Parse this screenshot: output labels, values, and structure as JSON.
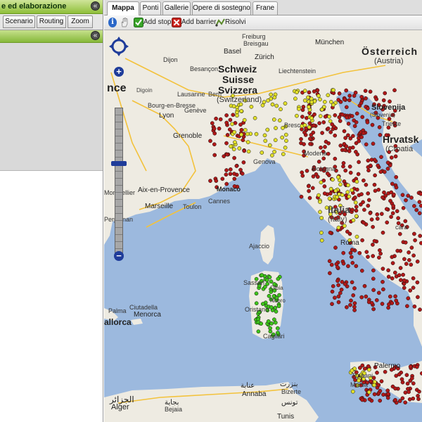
{
  "left_panel": {
    "header_title": "e ed elaborazione",
    "collapse_icon": "«",
    "tabs": [
      "Scenario",
      "Routing",
      "Zoom"
    ]
  },
  "map_tabs": [
    "Mappa",
    "Ponti",
    "Gallerie",
    "Opere di sostegno",
    "Frane"
  ],
  "toolbar": {
    "info_icon": "i",
    "add_stop": "Add stop",
    "add_barrier": "Add barrier",
    "solve": "Risolvi"
  },
  "map_labels": {
    "freiburg": "Freiburg",
    "breisgau": "Breisgau",
    "basel": "Basel",
    "zurich": "Zürich",
    "munchen": "München",
    "osterreich": "Österreich",
    "austria": "(Austria)",
    "schweiz": "Schweiz",
    "suisse": "Suisse",
    "svizzera": "Svizzera",
    "switzerland": "(Switzerland)",
    "liechtenstein": "Liechtenstein",
    "france_partial": "nce",
    "dijon": "Dijon",
    "besancon": "Besançon",
    "lausanne": "Lausanne",
    "bern": "Bern",
    "digoin": "Digoin",
    "bourg": "Bourg-en-Bresse",
    "geneve": "Genève",
    "lyon": "Lyon",
    "grenoble": "Grenoble",
    "slovenija": "Slovenija",
    "slovenia": "(Slovenia)",
    "trieste": "Trieste",
    "hrvatska": "Hrvatsk",
    "croatia": "(Croatia",
    "aix": "Aix-en-Provence",
    "montpellier": "Montpellier",
    "monaco": "Monaco",
    "marseille": "Marseille",
    "toulon": "Toulon",
    "cannes": "Cannes",
    "perpignan": "Perpignan",
    "genova": "Genova",
    "brescia": "Bresc",
    "modena": "Modena",
    "bologna": "Bologna",
    "italia": "Italia",
    "italy": "(Italy)",
    "roma": "Roma",
    "pescara": "cara",
    "ajaccio": "Ajaccio",
    "sassari": "Sassari",
    "oristano": "Oristano",
    "cagliari": "Cagliari",
    "palma": "Palma",
    "mallorca": "allorca",
    "ciutadella": "Ciutadella",
    "menorca": "Menorca",
    "palermo": "Palermo",
    "trapani": "Trapani",
    "marsala": "Marsa",
    "algiers_ar": "الجزائر",
    "alger": "Alger",
    "annaba_ar": "عنابة",
    "annaba": "Annaba",
    "bizerte_ar": "بنزرت",
    "bizerte": "Bizerte",
    "tunis_ar": "تونس",
    "tunis": "Tunis",
    "bejaia_ar": "بجاية",
    "bejaia": "Bejaia",
    "sardinia_place1": "Olbia",
    "sardinia_place2": "Nuoro"
  },
  "colors": {
    "sea": "#9cb9de",
    "land": "#eeebe2",
    "motorway": "#f3c23b",
    "point_red": "#b01818",
    "point_yellow": "#e1df2a",
    "point_green": "#3ec41a"
  },
  "zoom": {
    "plus": "+",
    "minus": "−",
    "level_fraction": 0.62
  }
}
